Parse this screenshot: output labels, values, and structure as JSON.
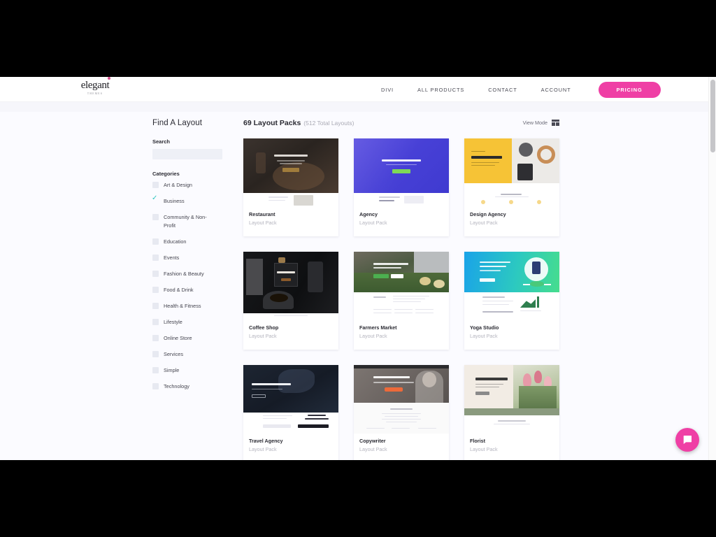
{
  "header": {
    "logo_word": "elegant",
    "logo_sub": "THEMES",
    "nav": [
      {
        "label": "DIVI"
      },
      {
        "label": "ALL PRODUCTS"
      },
      {
        "label": "CONTACT"
      },
      {
        "label": "ACCOUNT"
      }
    ],
    "pricing_label": "PRICING",
    "accent_color": "#ef3fa5"
  },
  "sidebar": {
    "title": "Find A Layout",
    "search_label": "Search",
    "search_value": "",
    "search_placeholder": "",
    "categories_label": "Categories",
    "check_color": "#2ec5c0",
    "categories": [
      {
        "label": "Art & Design",
        "checked": false
      },
      {
        "label": "Business",
        "checked": true
      },
      {
        "label": "Community & Non-Profit",
        "checked": false
      },
      {
        "label": "Education",
        "checked": false
      },
      {
        "label": "Events",
        "checked": false
      },
      {
        "label": "Fashion & Beauty",
        "checked": false
      },
      {
        "label": "Food & Drink",
        "checked": false
      },
      {
        "label": "Health & Fitness",
        "checked": false
      },
      {
        "label": "Lifestyle",
        "checked": false
      },
      {
        "label": "Online Store",
        "checked": false
      },
      {
        "label": "Services",
        "checked": false
      },
      {
        "label": "Simple",
        "checked": false
      },
      {
        "label": "Technology",
        "checked": false
      }
    ]
  },
  "results": {
    "count_label": "69 Layout Packs",
    "total_label": "(512 Total Layouts)",
    "view_mode_label": "View Mode",
    "cards": [
      {
        "title": "Restaurant",
        "subtitle": "Layout Pack",
        "hero_text": "TWO CLUB IN TOWN"
      },
      {
        "title": "Agency",
        "subtitle": "Layout Pack",
        "hero_text": "We Do Business"
      },
      {
        "title": "Design Agency",
        "subtitle": "Layout Pack",
        "hero_text": "DESIGN AGENCY"
      },
      {
        "title": "Coffee Shop",
        "subtitle": "Layout Pack",
        "hero_text": "COFFEE HOUSE"
      },
      {
        "title": "Farmers Market",
        "subtitle": "Layout Pack",
        "hero_text": "Progressive Foods Right In Your Style"
      },
      {
        "title": "Yoga Studio",
        "subtitle": "Layout Pack",
        "hero_text": "Find Your Balance Achieve Inner Calm"
      },
      {
        "title": "Travel Agency",
        "subtitle": "Layout Pack",
        "hero_text": "EXPLORE THE WORLD"
      },
      {
        "title": "Copywriter",
        "subtitle": "Layout Pack",
        "hero_text": "HELLO, I'M JANE"
      },
      {
        "title": "Florist",
        "subtitle": "Layout Pack",
        "hero_text": "Flower Shop"
      }
    ]
  },
  "chat": {
    "icon": "speech-bubble-icon",
    "color": "#ef3fa5"
  }
}
